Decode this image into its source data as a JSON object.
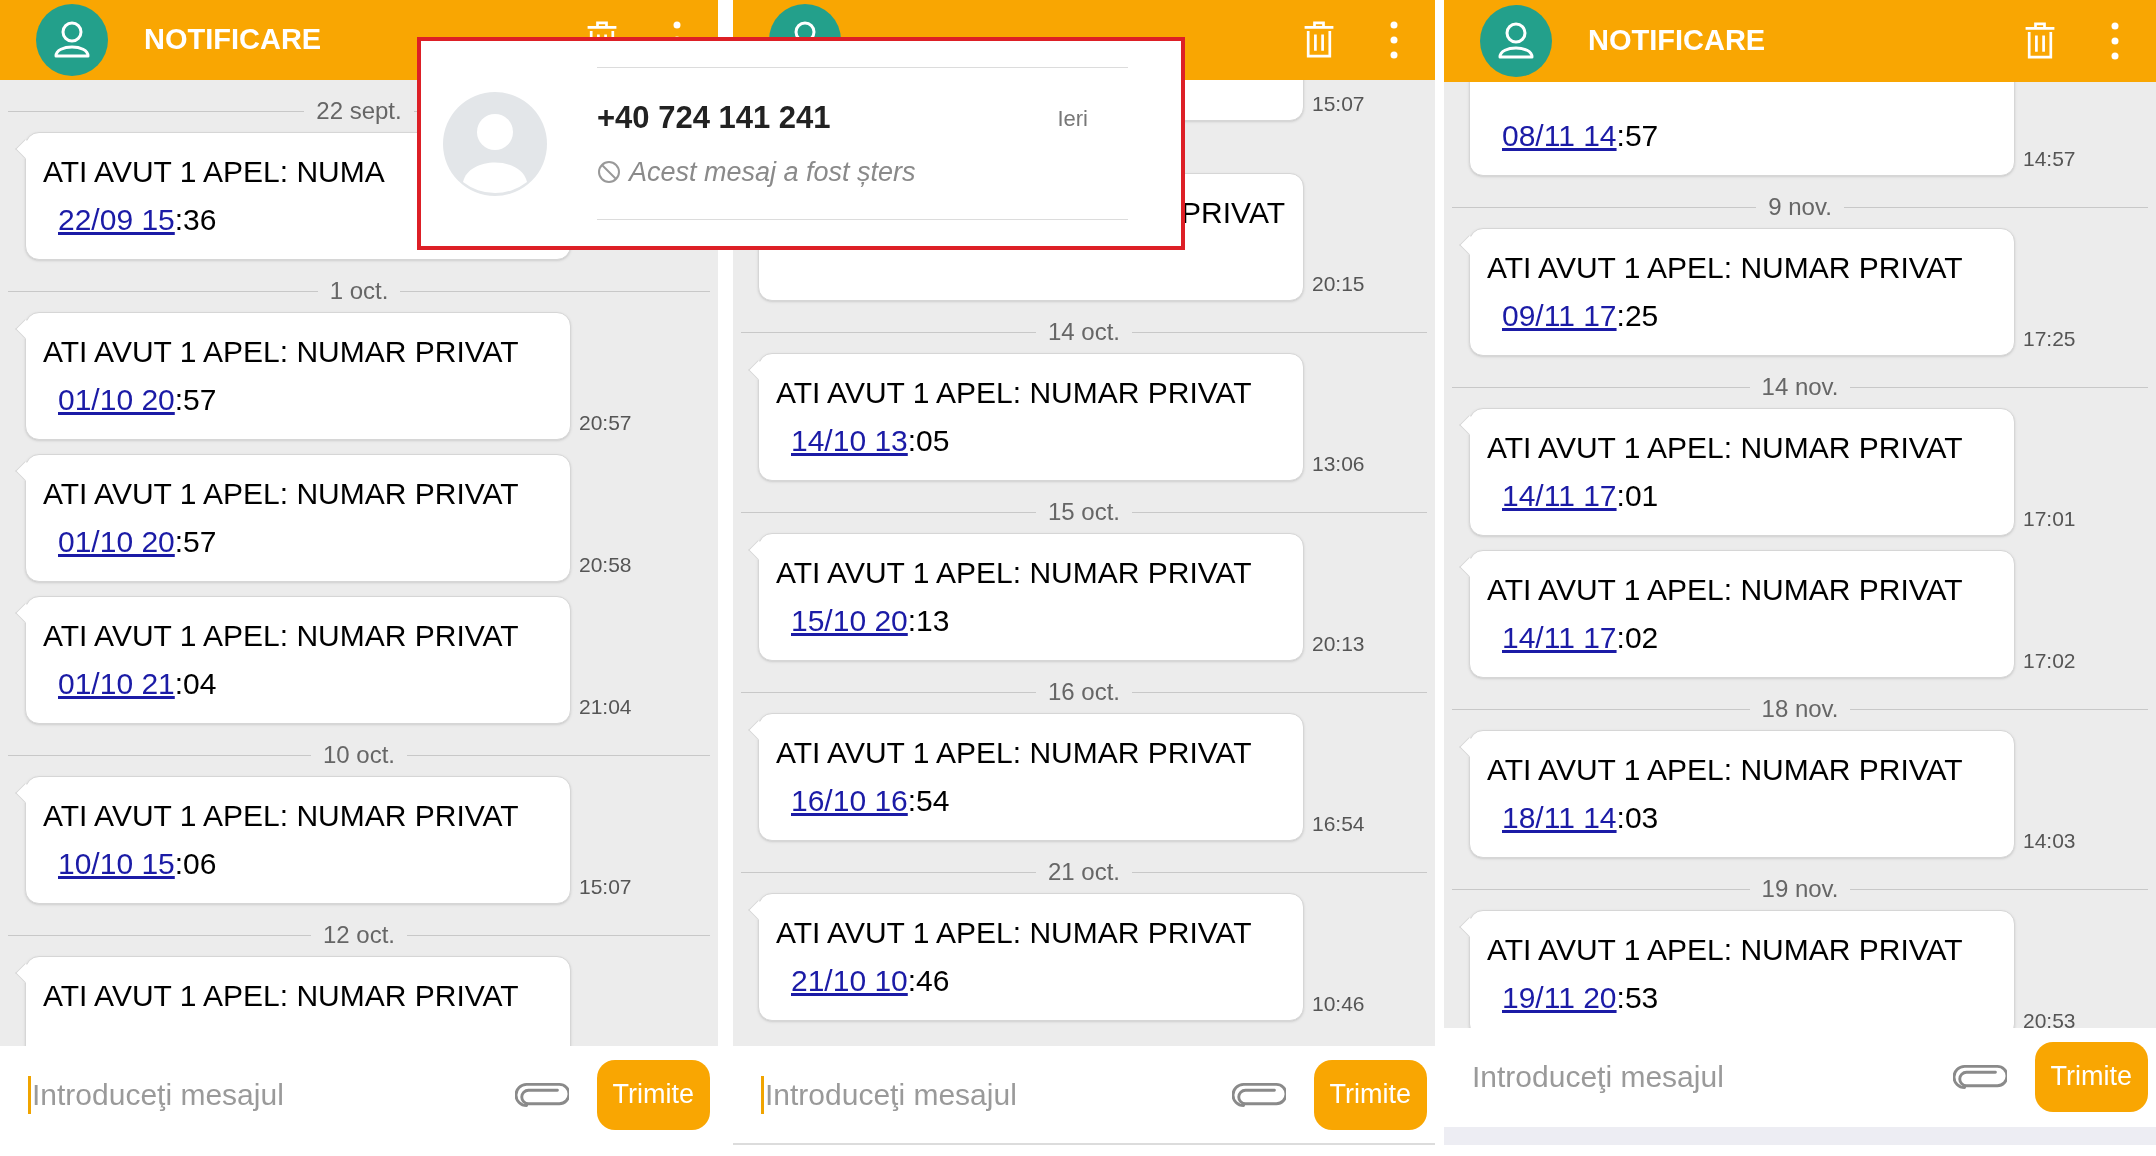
{
  "panels": [
    {
      "header": {
        "title": "NOTIFICARE"
      },
      "items": [
        {
          "kind": "date",
          "label": "22 sept."
        },
        {
          "kind": "message",
          "text": "ATI AVUT 1 APEL: NUMA",
          "link": "22/09 15",
          "rest": ":36"
        },
        {
          "kind": "date",
          "label": "1 oct."
        },
        {
          "kind": "message",
          "text": "ATI AVUT 1 APEL: NUMAR PRIVAT",
          "link": "01/10 20",
          "rest": ":57",
          "time": "20:57"
        },
        {
          "kind": "message",
          "text": "ATI AVUT 1 APEL: NUMAR PRIVAT",
          "link": "01/10 20",
          "rest": ":57",
          "time": "20:58"
        },
        {
          "kind": "message",
          "text": "ATI AVUT 1 APEL: NUMAR PRIVAT",
          "link": "01/10 21",
          "rest": ":04",
          "time": "21:04"
        },
        {
          "kind": "date",
          "label": "10 oct."
        },
        {
          "kind": "message",
          "text": "ATI AVUT 1 APEL: NUMAR PRIVAT",
          "link": "10/10 15",
          "rest": ":06",
          "time": "15:07"
        },
        {
          "kind": "date",
          "label": "12 oct."
        },
        {
          "kind": "message",
          "text": "ATI AVUT 1 APEL: NUMAR PRIVAT"
        }
      ],
      "composer": {
        "placeholder": "Introduceţi mesajul",
        "focused": true,
        "send_label": "Trimite"
      }
    },
    {
      "items": [
        {
          "kind": "message",
          "time": "15:07"
        },
        {
          "kind": "date"
        },
        {
          "kind": "covered_message",
          "text": "PRIVAT",
          "time": "20:15"
        },
        {
          "kind": "date",
          "label": "14 oct."
        },
        {
          "kind": "message",
          "text": "ATI AVUT 1 APEL: NUMAR PRIVAT",
          "link": "14/10 13",
          "rest": ":05",
          "time": "13:06"
        },
        {
          "kind": "date",
          "label": "15 oct."
        },
        {
          "kind": "message",
          "text": "ATI AVUT 1 APEL: NUMAR PRIVAT",
          "link": "15/10 20",
          "rest": ":13",
          "time": "20:13"
        },
        {
          "kind": "date",
          "label": "16 oct."
        },
        {
          "kind": "message",
          "text": "ATI AVUT 1 APEL: NUMAR PRIVAT",
          "link": "16/10 16",
          "rest": ":54",
          "time": "16:54"
        },
        {
          "kind": "date",
          "label": "21 oct."
        },
        {
          "kind": "message",
          "text": "ATI AVUT 1 APEL: NUMAR PRIVAT",
          "link": "21/10 10",
          "rest": ":46",
          "time": "10:46"
        }
      ],
      "composer": {
        "placeholder": "Introduceţi mesajul",
        "focused": true,
        "send_label": "Trimite"
      }
    },
    {
      "header": {
        "title": "NOTIFICARE"
      },
      "items": [
        {
          "kind": "message",
          "link": "08/11 14",
          "rest": ":57",
          "time": "14:57"
        },
        {
          "kind": "date",
          "label": "9 nov."
        },
        {
          "kind": "message",
          "text": "ATI AVUT 1 APEL: NUMAR PRIVAT",
          "link": "09/11 17",
          "rest": ":25",
          "time": "17:25"
        },
        {
          "kind": "date",
          "label": "14 nov."
        },
        {
          "kind": "message",
          "text": "ATI AVUT 1 APEL: NUMAR PRIVAT",
          "link": "14/11 17",
          "rest": ":01",
          "time": "17:01"
        },
        {
          "kind": "message",
          "text": "ATI AVUT 1 APEL: NUMAR PRIVAT",
          "link": "14/11 17",
          "rest": ":02",
          "time": "17:02"
        },
        {
          "kind": "date",
          "label": "18 nov."
        },
        {
          "kind": "message",
          "text": "ATI AVUT 1 APEL: NUMAR PRIVAT",
          "link": "18/11 14",
          "rest": ":03",
          "time": "14:03"
        },
        {
          "kind": "date",
          "label": "19 nov."
        },
        {
          "kind": "message",
          "text": "ATI AVUT 1 APEL: NUMAR PRIVAT",
          "link": "19/11 20",
          "rest": ":53",
          "time": "20:53"
        }
      ],
      "composer": {
        "placeholder": "Introduceţi mesajul",
        "focused": false,
        "send_label": "Trimite"
      }
    }
  ],
  "notification": {
    "sender": "+40 724 141 241",
    "time": "Ieri",
    "text": "Acest mesaj a fost șters"
  }
}
